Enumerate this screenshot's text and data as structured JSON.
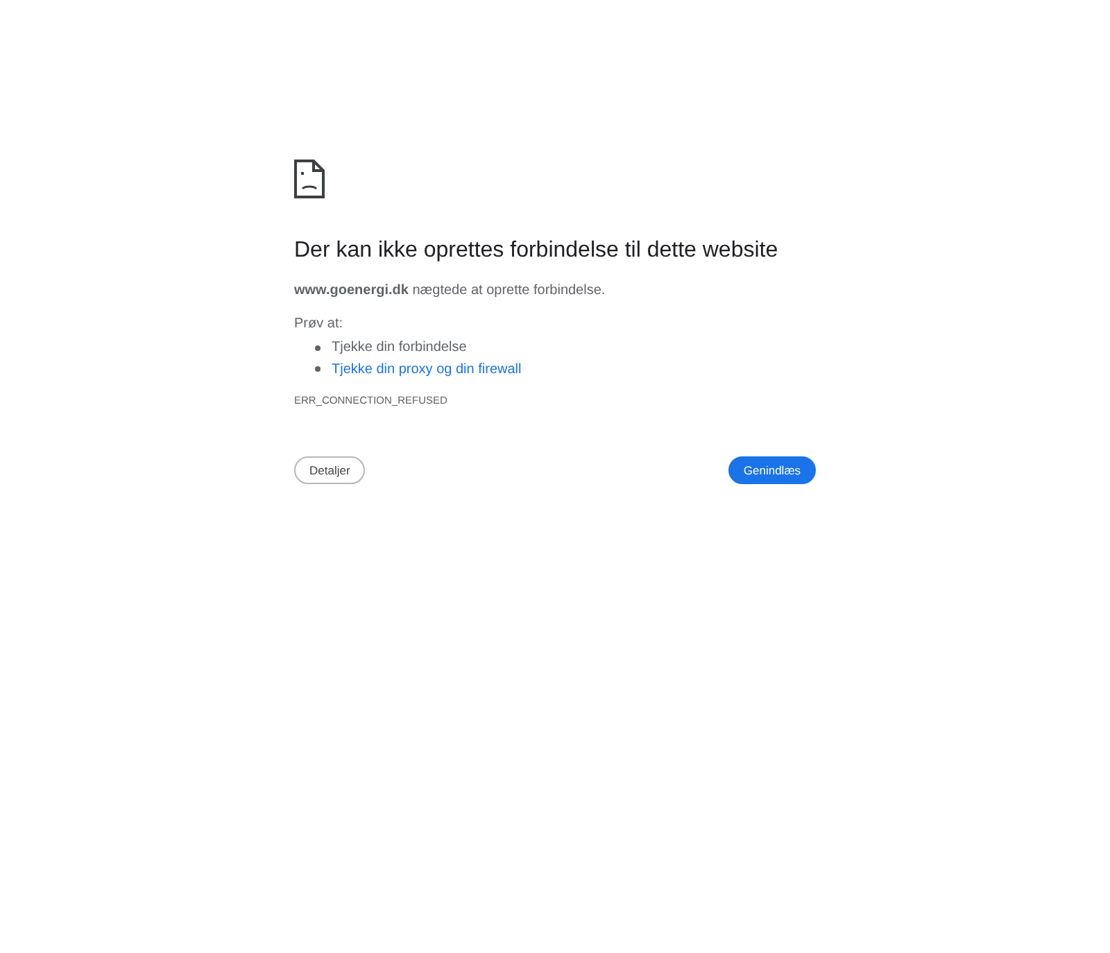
{
  "heading": "Der kan ikke oprettes forbindelse til dette website",
  "message": "**www.goenergi.dk** nægtede at oprette forbindelse.",
  "suggestions_label": "Prøv at:",
  "suggestions": [
    {
      "kind": "text",
      "label": "Tjekke din forbindelse"
    },
    {
      "kind": "link",
      "label": "Tjekke din proxy og din firewall"
    }
  ],
  "error_code": "ERR_CONNECTION_REFUSED",
  "buttons": [
    {
      "kind": "secondary",
      "label": "Detaljer"
    },
    {
      "kind": "primary",
      "label": "Genindlæs"
    }
  ]
}
